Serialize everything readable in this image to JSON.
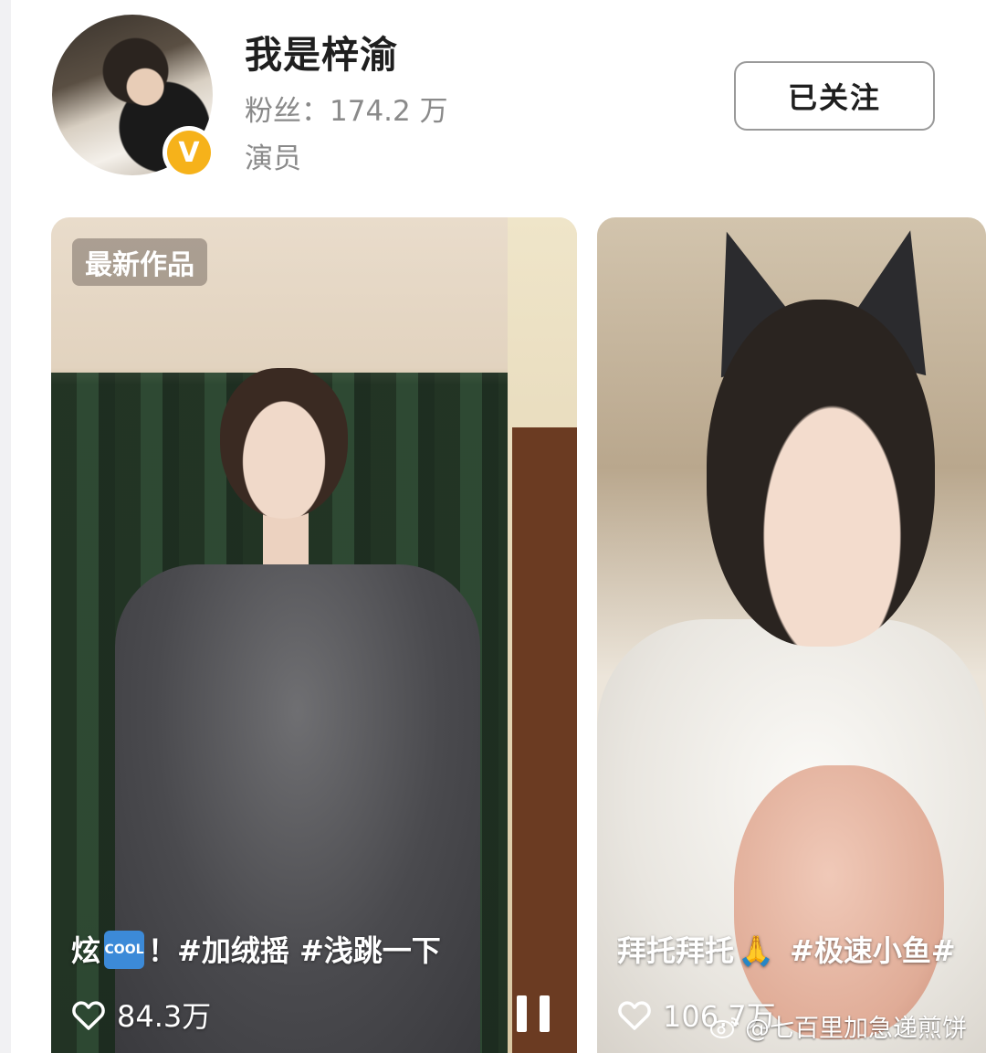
{
  "profile": {
    "name": "我是梓渝",
    "followers_label": "粉丝：",
    "followers_count": "174.2 万",
    "profession": "演员",
    "verified": true,
    "verified_badge_letter": "V",
    "badge_color": "#f6b21a"
  },
  "follow_button": {
    "label": "已关注"
  },
  "videos": [
    {
      "tag": "最新作品",
      "caption_prefix": "炫",
      "caption_emoji": "COOL",
      "caption_suffix": "！#加绒摇 #浅跳一下",
      "likes": "84.3万",
      "playing": true
    },
    {
      "caption_prefix": "拜托拜托",
      "caption_suffix": " #极速小鱼#",
      "likes": "106.7万"
    }
  ],
  "watermark": {
    "text": "@七百里加急递煎饼"
  }
}
